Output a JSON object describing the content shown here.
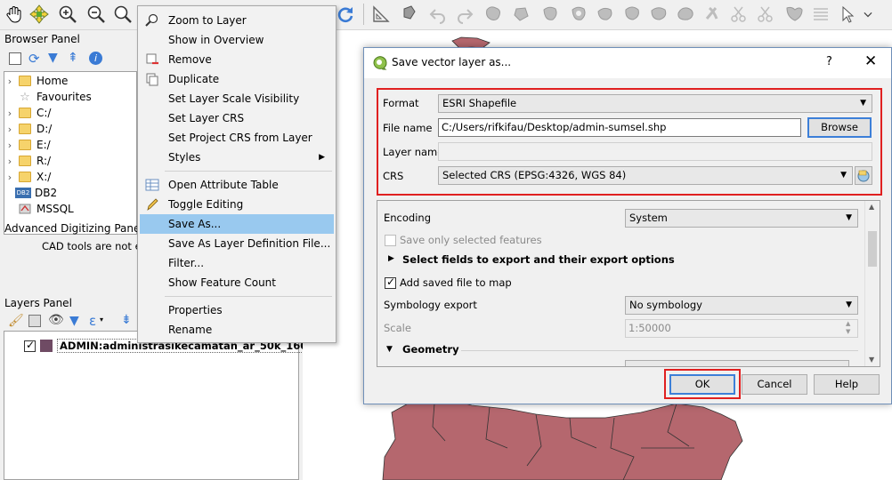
{
  "toolbar": {
    "icons": [
      "pan-icon",
      "pan-to-selection-icon",
      "zoom-in-icon",
      "zoom-out-icon",
      "zoom-actual-icon",
      "refresh-icon",
      "measure-icon",
      "digitize-icon",
      "undo-icon",
      "redo-icon"
    ]
  },
  "browser_panel": {
    "title": "Browser Panel",
    "items": [
      {
        "label": "Home",
        "icon": "folder-icon",
        "expandable": true
      },
      {
        "label": "Favourites",
        "icon": "star-icon",
        "expandable": false
      },
      {
        "label": "C:/",
        "icon": "folder-icon",
        "expandable": true
      },
      {
        "label": "D:/",
        "icon": "folder-icon",
        "expandable": true
      },
      {
        "label": "E:/",
        "icon": "folder-icon",
        "expandable": true
      },
      {
        "label": "R:/",
        "icon": "folder-icon",
        "expandable": true
      },
      {
        "label": "X:/",
        "icon": "folder-icon",
        "expandable": true
      },
      {
        "label": "DB2",
        "icon": "db2-icon",
        "expandable": false
      },
      {
        "label": "MSSQL",
        "icon": "mssql-icon",
        "expandable": false
      }
    ]
  },
  "advanced_digitizing": {
    "title": "Advanced Digitizing Panel",
    "message": "CAD tools are not ena"
  },
  "layers_panel": {
    "title": "Layers Panel",
    "layer": {
      "name": "ADMIN:administrasikecamatan_ar_50k_160...",
      "checked": true
    }
  },
  "context_menu": {
    "items": [
      {
        "label": "Zoom to Layer",
        "icon": "zoom-to-layer-icon"
      },
      {
        "label": "Show in Overview",
        "icon": ""
      },
      {
        "label": "Remove",
        "icon": "remove-icon"
      },
      {
        "label": "Duplicate",
        "icon": "duplicate-icon"
      },
      {
        "label": "Set Layer Scale Visibility",
        "icon": ""
      },
      {
        "label": "Set Layer CRS",
        "icon": ""
      },
      {
        "label": "Set Project CRS from Layer",
        "icon": ""
      },
      {
        "label": "Styles",
        "icon": "",
        "submenu": true
      },
      {
        "label": "Open Attribute Table",
        "icon": "attribute-table-icon"
      },
      {
        "label": "Toggle Editing",
        "icon": "pencil-icon"
      },
      {
        "label": "Save As...",
        "icon": "",
        "selected": true
      },
      {
        "label": "Save As Layer Definition File...",
        "icon": ""
      },
      {
        "label": "Filter...",
        "icon": ""
      },
      {
        "label": "Show Feature Count",
        "icon": ""
      },
      {
        "label": "Properties",
        "icon": ""
      },
      {
        "label": "Rename",
        "icon": ""
      }
    ]
  },
  "dialog": {
    "title": "Save vector layer as...",
    "help_glyph": "?",
    "close_glyph": "✕",
    "format_label": "Format",
    "format_value": "ESRI Shapefile",
    "filename_label": "File name",
    "filename_value": "C:/Users/rifkifau/Desktop/admin-sumsel.shp",
    "browse_label": "Browse",
    "layername_label": "Layer name",
    "layername_value": "",
    "crs_label": "CRS",
    "crs_value": "Selected CRS (EPSG:4326, WGS 84)",
    "encoding_label": "Encoding",
    "encoding_value": "System",
    "save_only_selected_label": "Save only selected features",
    "save_only_selected_checked": false,
    "select_fields_label": "Select fields to export and their export options",
    "add_saved_label": "Add saved file to map",
    "add_saved_checked": true,
    "symbology_label": "Symbology export",
    "symbology_value": "No symbology",
    "scale_label": "Scale",
    "scale_value": "1:50000",
    "geometry_label": "Geometry",
    "ok_label": "OK",
    "cancel_label": "Cancel",
    "help_label": "Help"
  },
  "colors": {
    "map_polygon": "#b5676e",
    "highlight_red": "#e02020",
    "menu_selection": "#99c9ef"
  }
}
